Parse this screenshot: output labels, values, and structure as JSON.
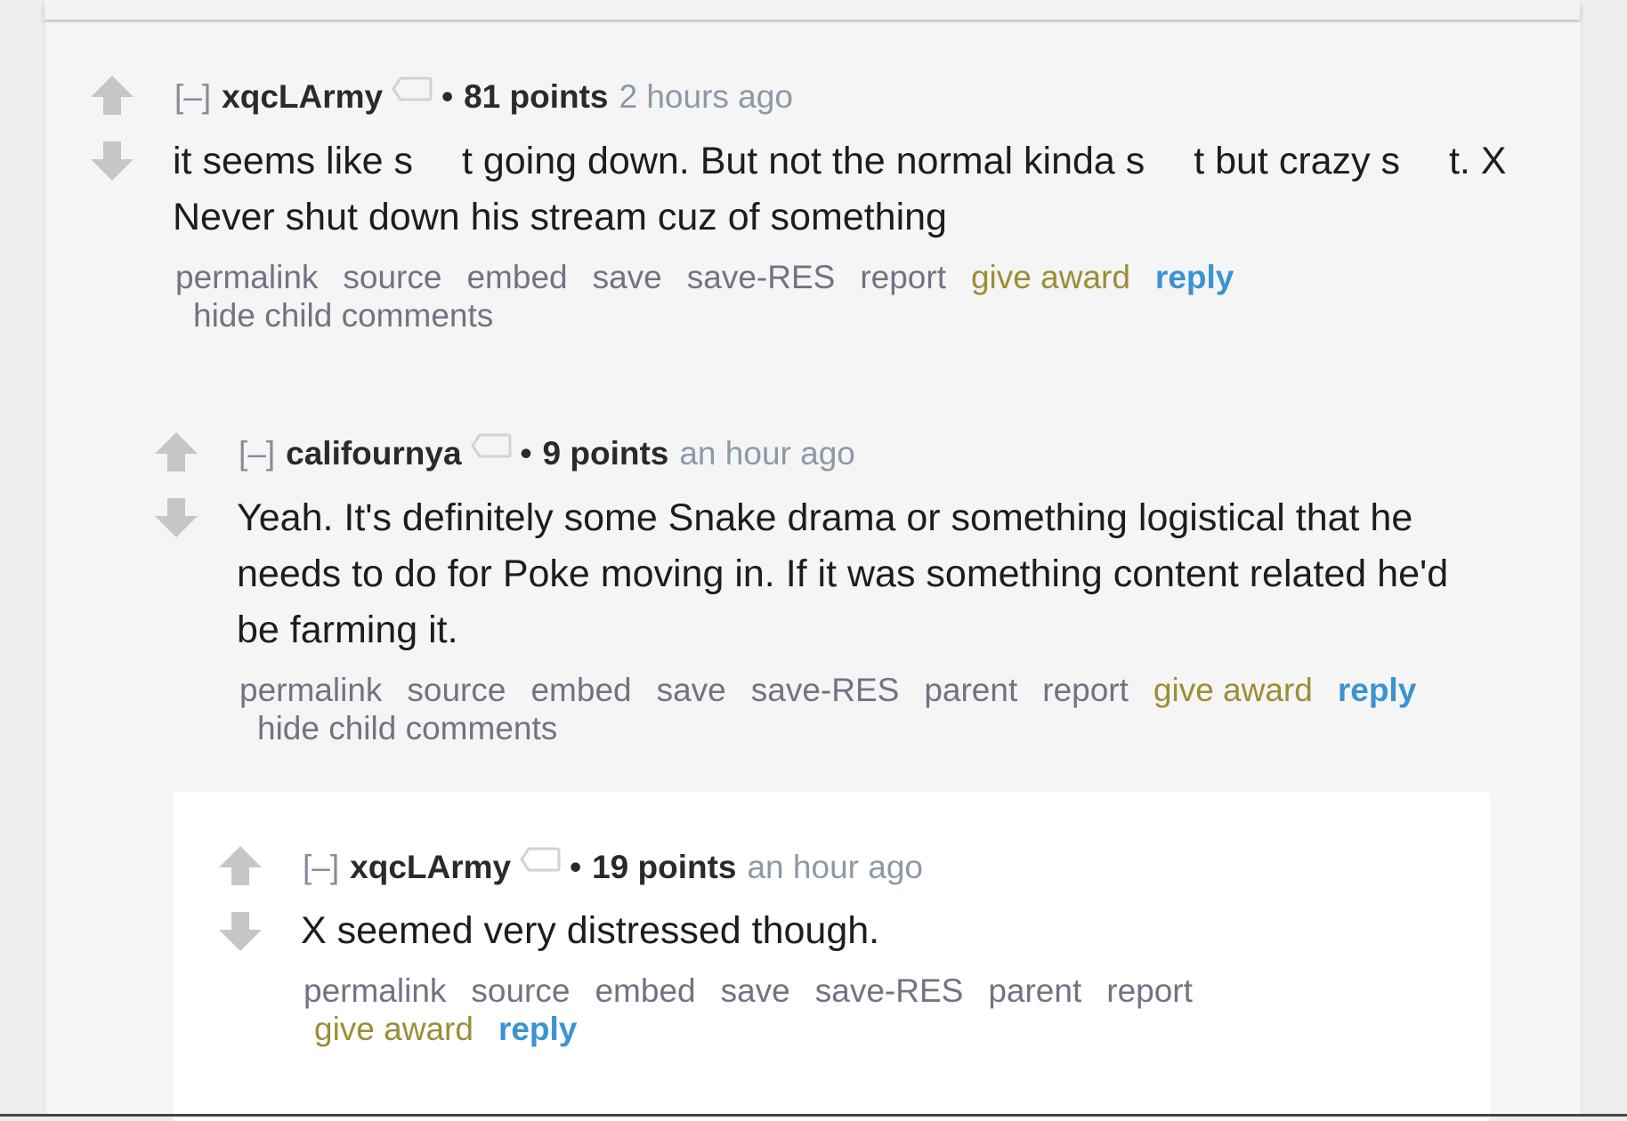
{
  "comments": [
    {
      "expand_label": "[–]",
      "author": "xqcLArmy",
      "separator": "•",
      "score": "81 points",
      "time": "2 hours ago",
      "body_line1": "it seems like s  t going down. But not the normal kinda s  t but crazy s  t. X",
      "body_line2": "Never shut down his stream cuz of something",
      "buttons": {
        "permalink": "permalink",
        "source": "source",
        "embed": "embed",
        "save": "save",
        "save_res": "save-RES",
        "report": "report",
        "give_award": "give award",
        "reply": "reply",
        "hide_children": "hide child comments"
      }
    },
    {
      "expand_label": "[–]",
      "author": "califournya",
      "separator": "•",
      "score": "9 points",
      "time": "an hour ago",
      "body_line1": "Yeah. It's definitely some Snake drama or something logistical that he",
      "body_line2": "needs to do for Poke moving in. If it was something content related he'd",
      "body_line3": "be farming it.",
      "buttons": {
        "permalink": "permalink",
        "source": "source",
        "embed": "embed",
        "save": "save",
        "save_res": "save-RES",
        "parent": "parent",
        "report": "report",
        "give_award": "give award",
        "reply": "reply",
        "hide_children": "hide child comments"
      }
    },
    {
      "expand_label": "[–]",
      "author": "xqcLArmy",
      "separator": "•",
      "score": "19 points",
      "time": "an hour ago",
      "body_line1": "X seemed very distressed though.",
      "buttons": {
        "permalink": "permalink",
        "source": "source",
        "embed": "embed",
        "save": "save",
        "save_res": "save-RES",
        "parent": "parent",
        "report": "report",
        "give_award": "give award",
        "reply": "reply"
      }
    }
  ],
  "colors": {
    "vote_arrow": "#c6c6c6",
    "author": "#2a2a2a",
    "time": "#8d99a8",
    "button": "#777084",
    "award": "#9b8e35",
    "reply": "#3a94d0"
  },
  "icons": {
    "upvote": "upvote-arrow-icon",
    "downvote": "downvote-arrow-icon",
    "flair": "user-tag-icon"
  }
}
